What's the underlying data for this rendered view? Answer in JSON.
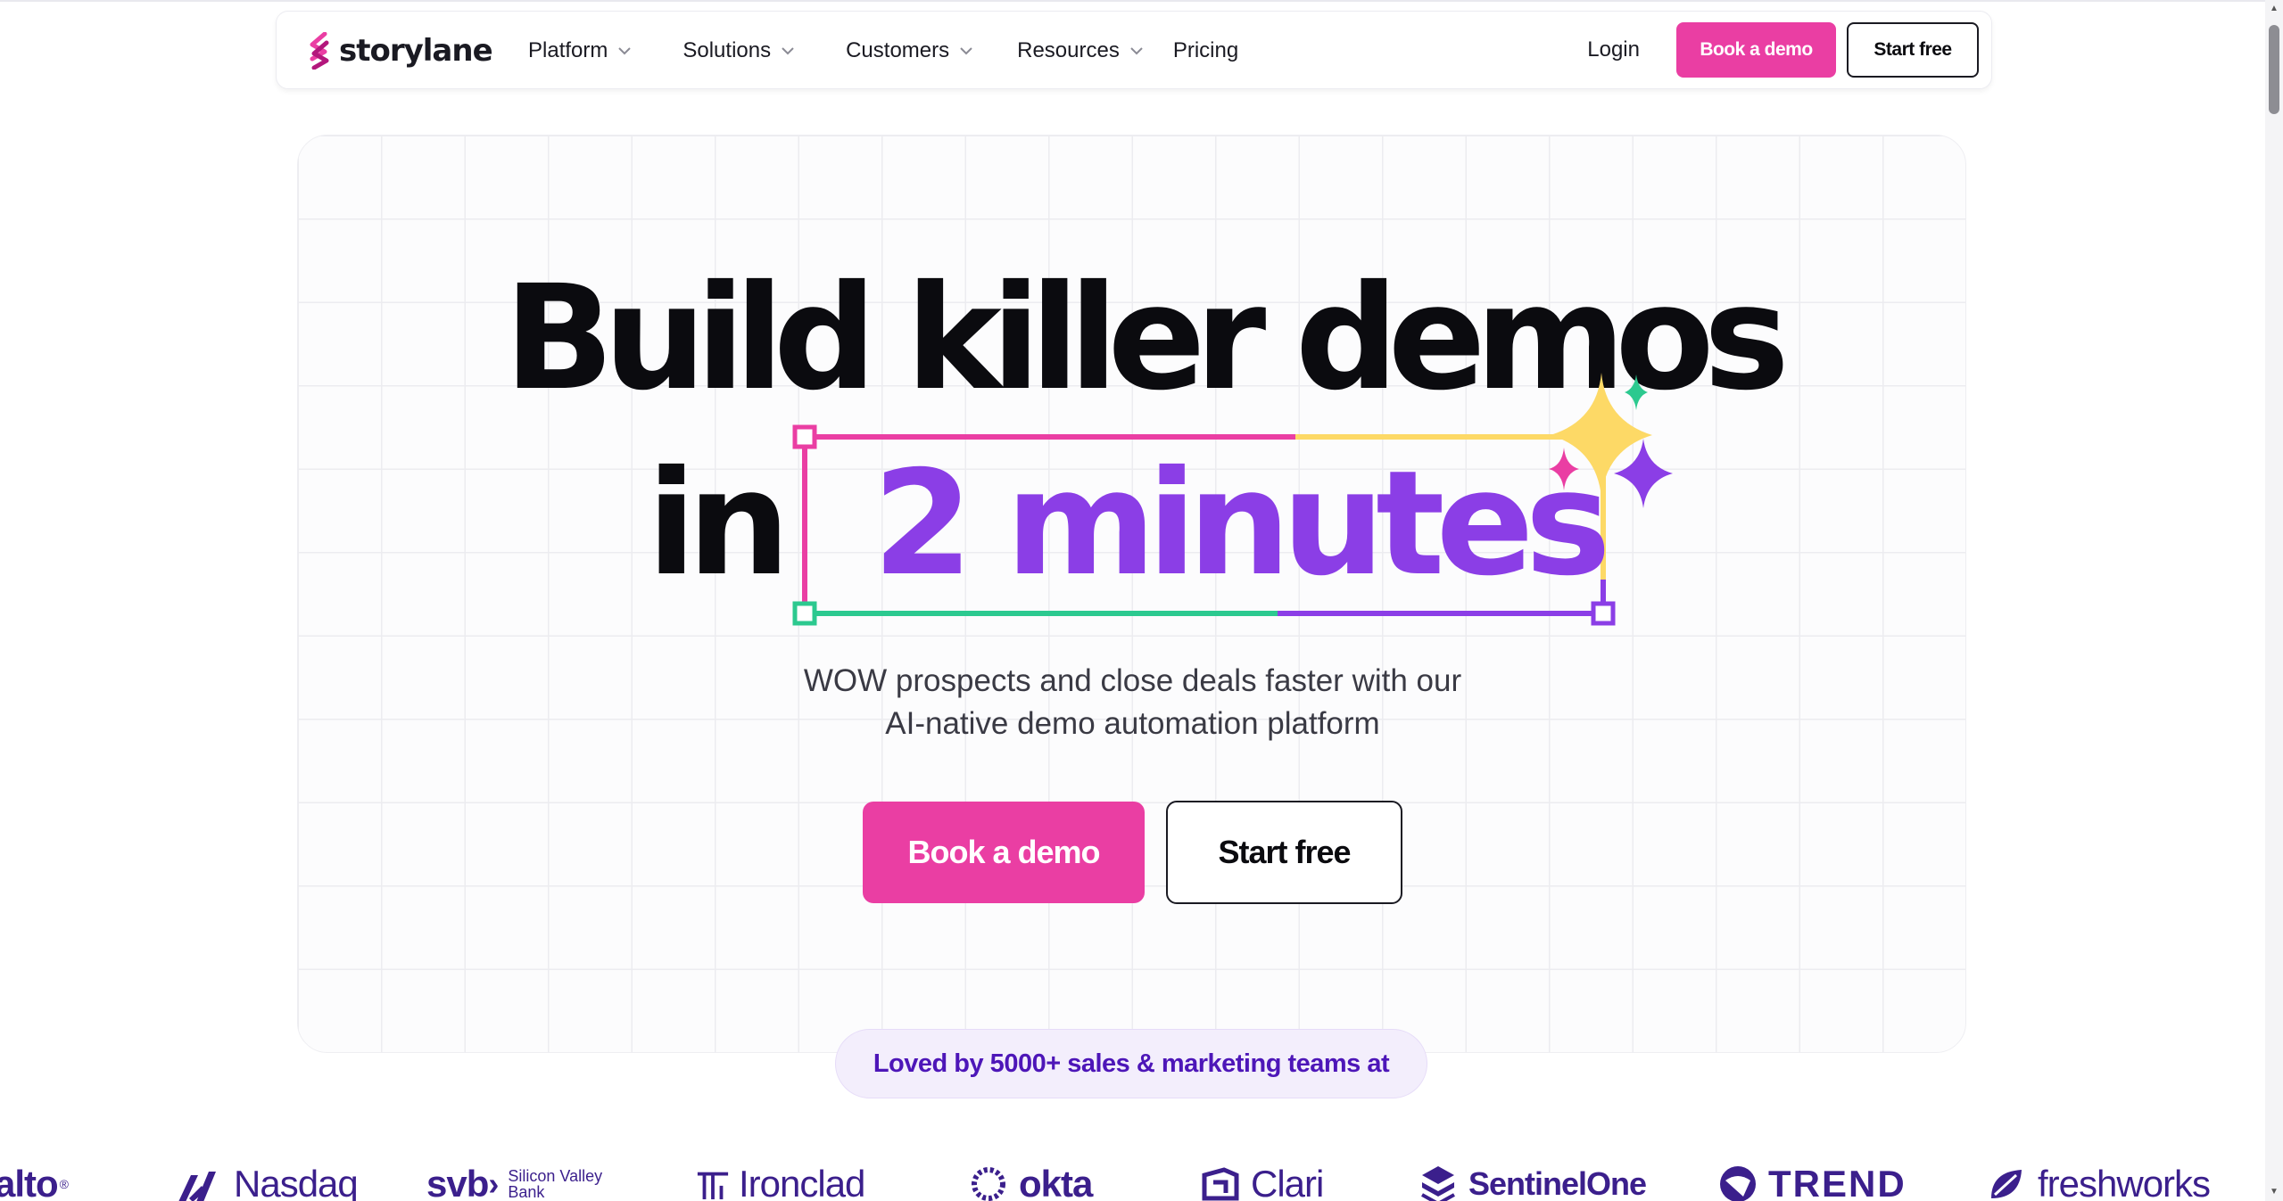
{
  "nav": {
    "logo_text": "storylane",
    "items": [
      {
        "label": "Platform",
        "has_dropdown": true
      },
      {
        "label": "Solutions",
        "has_dropdown": true
      },
      {
        "label": "Customers",
        "has_dropdown": true
      },
      {
        "label": "Resources",
        "has_dropdown": true
      },
      {
        "label": "Pricing",
        "has_dropdown": false
      }
    ],
    "login": "Login",
    "book_demo": "Book a demo",
    "start_free": "Start free"
  },
  "hero": {
    "line1": "Build killer demos",
    "line2_prefix": "in",
    "line2_highlight": "2 minutes",
    "subtitle_line1": "WOW prospects and close deals faster with our",
    "subtitle_line2": "AI-native demo automation platform",
    "cta_primary": "Book a demo",
    "cta_secondary": "Start free"
  },
  "social_proof": {
    "text": "Loved by 5000+ sales & marketing teams at",
    "logos": [
      {
        "name": "alto",
        "icon": "none"
      },
      {
        "name": "Nasdaq",
        "icon": "nasdaq-chevron-icon"
      },
      {
        "name": "svb",
        "sub": "Silicon Valley Bank",
        "icon": "none"
      },
      {
        "name": "Ironclad",
        "icon": "ironclad-icon"
      },
      {
        "name": "okta",
        "icon": "okta-ring-icon"
      },
      {
        "name": "Clari",
        "icon": "clari-icon"
      },
      {
        "name": "SentinelOne",
        "icon": "sentinelone-icon"
      },
      {
        "name": "TREND",
        "icon": "trend-icon"
      },
      {
        "name": "freshworks",
        "icon": "freshworks-icon"
      }
    ]
  },
  "colors": {
    "brand_pink": "#ea3ea3",
    "brand_purple": "#8b3ee6",
    "accent_green": "#2cc98f",
    "accent_yellow": "#fdd966",
    "logo_purple": "#3b1f8c"
  }
}
